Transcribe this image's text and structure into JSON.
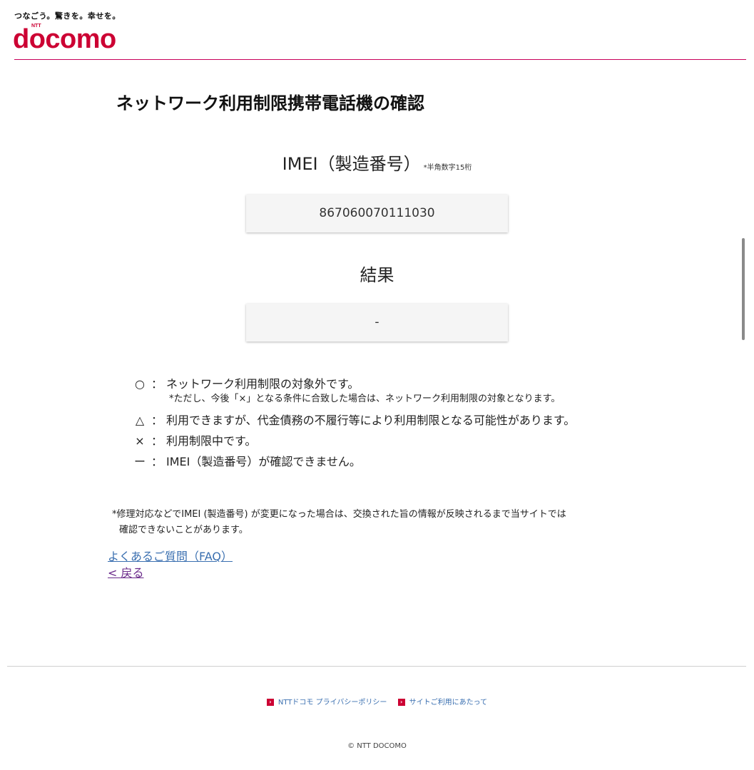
{
  "header": {
    "tagline": "つなごう。驚きを。幸せを。",
    "logo_ntt": "NTT",
    "logo_text": "docomo",
    "brand_color": "#cc0033"
  },
  "main": {
    "title": "ネットワーク利用制限携帯電話機の確認",
    "imei_label": "IMEI（製造番号）",
    "imei_note": "*半角数字15桁",
    "imei_value": "867060070111030",
    "result_label": "結果",
    "result_value": "-"
  },
  "legend": {
    "circle": {
      "symbol": "○",
      "colon": "：",
      "text": "ネットワーク利用制限の対象外です。"
    },
    "circle_note": "*ただし、今後「×」となる条件に合致した場合は、ネットワーク利用制限の対象となります。",
    "triangle": {
      "symbol": "△",
      "colon": "：",
      "text": "利用できますが、代金債務の不履行等により利用制限となる可能性があります。"
    },
    "cross": {
      "symbol": "×",
      "colon": "：",
      "text": "利用制限中です。"
    },
    "dash": {
      "symbol": "ー",
      "colon": "：",
      "text": "IMEI（製造番号）が確認できません。"
    }
  },
  "note": {
    "line1": "*修理対応などでIMEI (製造番号) が変更になった場合は、交換された旨の情報が反映されるまで当サイトでは",
    "line2": "確認できないことがあります。"
  },
  "links": {
    "faq": "よくあるご質問（FAQ）",
    "back": "< 戻る"
  },
  "footer": {
    "privacy": "NTTドコモ プライバシーポリシー",
    "site_usage": "サイトご利用にあたって",
    "copyright": "© NTT DOCOMO"
  }
}
